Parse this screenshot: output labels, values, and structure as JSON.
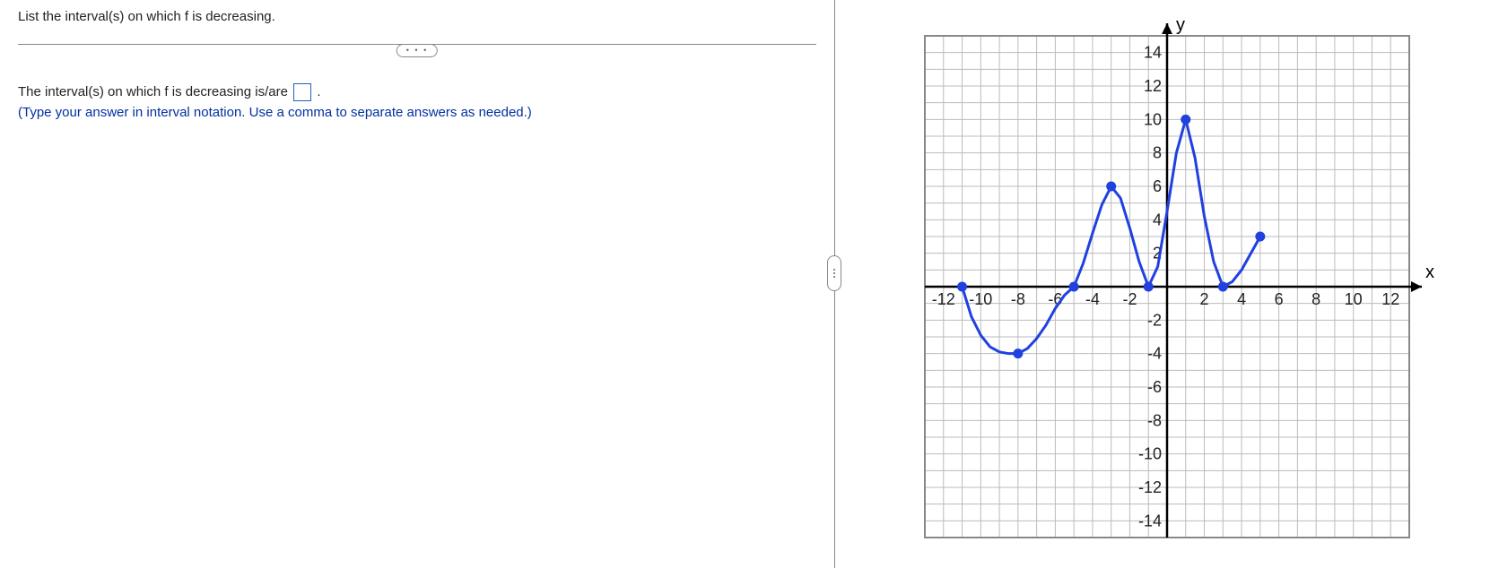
{
  "question": {
    "prompt": "List the interval(s) on which f is decreasing.",
    "answer_prefix": "The interval(s) on which f is decreasing is/are ",
    "answer_suffix": ".",
    "hint": "(Type your answer in interval notation. Use a comma to separate answers as needed.)"
  },
  "toggles": {
    "hr_pill": "• • •"
  },
  "chart_data": {
    "type": "line",
    "xlabel": "x",
    "ylabel": "y",
    "xlim": [
      -13,
      13
    ],
    "ylim": [
      -15,
      15
    ],
    "xticks": [
      -12,
      -10,
      -8,
      -6,
      -4,
      -2,
      2,
      4,
      6,
      8,
      10,
      12
    ],
    "yticks": [
      -14,
      -12,
      -10,
      -8,
      -6,
      -4,
      -2,
      2,
      4,
      6,
      8,
      10,
      12,
      14
    ],
    "grid": true,
    "series": [
      {
        "name": "f",
        "color": "#2040e0",
        "points_marked": [
          {
            "x": -11,
            "y": 0
          },
          {
            "x": -8,
            "y": -4
          },
          {
            "x": -5,
            "y": 0
          },
          {
            "x": -3,
            "y": 6
          },
          {
            "x": -1,
            "y": 0
          },
          {
            "x": 1,
            "y": 10
          },
          {
            "x": 3,
            "y": 0
          },
          {
            "x": 5,
            "y": 3
          }
        ],
        "curve_samples": [
          {
            "x": -11.0,
            "y": 0.0
          },
          {
            "x": -10.5,
            "y": -1.8
          },
          {
            "x": -10.0,
            "y": -2.9
          },
          {
            "x": -9.5,
            "y": -3.6
          },
          {
            "x": -9.0,
            "y": -3.9
          },
          {
            "x": -8.5,
            "y": -4.0
          },
          {
            "x": -8.0,
            "y": -4.0
          },
          {
            "x": -7.5,
            "y": -3.7
          },
          {
            "x": -7.0,
            "y": -3.1
          },
          {
            "x": -6.5,
            "y": -2.3
          },
          {
            "x": -6.0,
            "y": -1.3
          },
          {
            "x": -5.5,
            "y": -0.5
          },
          {
            "x": -5.0,
            "y": 0.0
          },
          {
            "x": -4.5,
            "y": 1.4
          },
          {
            "x": -4.0,
            "y": 3.2
          },
          {
            "x": -3.5,
            "y": 4.9
          },
          {
            "x": -3.0,
            "y": 6.0
          },
          {
            "x": -2.5,
            "y": 5.3
          },
          {
            "x": -2.0,
            "y": 3.5
          },
          {
            "x": -1.5,
            "y": 1.5
          },
          {
            "x": -1.0,
            "y": 0.0
          },
          {
            "x": -0.5,
            "y": 1.2
          },
          {
            "x": 0.0,
            "y": 4.5
          },
          {
            "x": 0.5,
            "y": 8.0
          },
          {
            "x": 1.0,
            "y": 10.0
          },
          {
            "x": 1.5,
            "y": 7.7
          },
          {
            "x": 2.0,
            "y": 4.2
          },
          {
            "x": 2.5,
            "y": 1.5
          },
          {
            "x": 3.0,
            "y": 0.0
          },
          {
            "x": 3.5,
            "y": 0.3
          },
          {
            "x": 4.0,
            "y": 1.0
          },
          {
            "x": 4.5,
            "y": 2.0
          },
          {
            "x": 5.0,
            "y": 3.0
          }
        ]
      }
    ]
  }
}
